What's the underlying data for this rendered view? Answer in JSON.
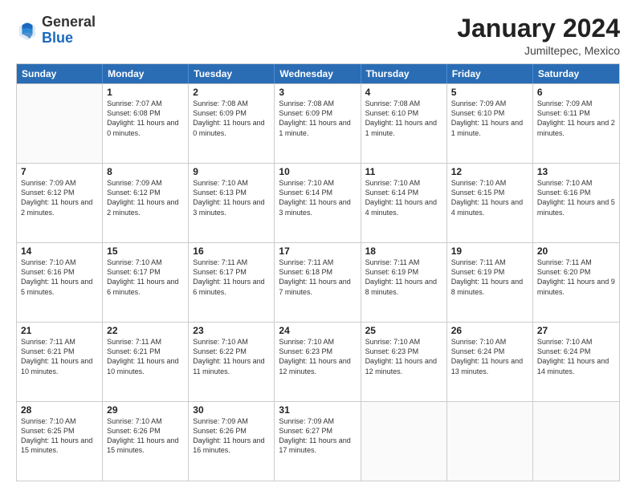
{
  "header": {
    "logo": {
      "general": "General",
      "blue": "Blue"
    },
    "title": "January 2024",
    "location": "Jumiltepec, Mexico"
  },
  "calendar": {
    "days_of_week": [
      "Sunday",
      "Monday",
      "Tuesday",
      "Wednesday",
      "Thursday",
      "Friday",
      "Saturday"
    ],
    "weeks": [
      [
        {
          "day": "",
          "sunrise": "",
          "sunset": "",
          "daylight": ""
        },
        {
          "day": "1",
          "sunrise": "Sunrise: 7:07 AM",
          "sunset": "Sunset: 6:08 PM",
          "daylight": "Daylight: 11 hours and 0 minutes."
        },
        {
          "day": "2",
          "sunrise": "Sunrise: 7:08 AM",
          "sunset": "Sunset: 6:09 PM",
          "daylight": "Daylight: 11 hours and 0 minutes."
        },
        {
          "day": "3",
          "sunrise": "Sunrise: 7:08 AM",
          "sunset": "Sunset: 6:09 PM",
          "daylight": "Daylight: 11 hours and 1 minute."
        },
        {
          "day": "4",
          "sunrise": "Sunrise: 7:08 AM",
          "sunset": "Sunset: 6:10 PM",
          "daylight": "Daylight: 11 hours and 1 minute."
        },
        {
          "day": "5",
          "sunrise": "Sunrise: 7:09 AM",
          "sunset": "Sunset: 6:10 PM",
          "daylight": "Daylight: 11 hours and 1 minute."
        },
        {
          "day": "6",
          "sunrise": "Sunrise: 7:09 AM",
          "sunset": "Sunset: 6:11 PM",
          "daylight": "Daylight: 11 hours and 2 minutes."
        }
      ],
      [
        {
          "day": "7",
          "sunrise": "Sunrise: 7:09 AM",
          "sunset": "Sunset: 6:12 PM",
          "daylight": "Daylight: 11 hours and 2 minutes."
        },
        {
          "day": "8",
          "sunrise": "Sunrise: 7:09 AM",
          "sunset": "Sunset: 6:12 PM",
          "daylight": "Daylight: 11 hours and 2 minutes."
        },
        {
          "day": "9",
          "sunrise": "Sunrise: 7:10 AM",
          "sunset": "Sunset: 6:13 PM",
          "daylight": "Daylight: 11 hours and 3 minutes."
        },
        {
          "day": "10",
          "sunrise": "Sunrise: 7:10 AM",
          "sunset": "Sunset: 6:14 PM",
          "daylight": "Daylight: 11 hours and 3 minutes."
        },
        {
          "day": "11",
          "sunrise": "Sunrise: 7:10 AM",
          "sunset": "Sunset: 6:14 PM",
          "daylight": "Daylight: 11 hours and 4 minutes."
        },
        {
          "day": "12",
          "sunrise": "Sunrise: 7:10 AM",
          "sunset": "Sunset: 6:15 PM",
          "daylight": "Daylight: 11 hours and 4 minutes."
        },
        {
          "day": "13",
          "sunrise": "Sunrise: 7:10 AM",
          "sunset": "Sunset: 6:16 PM",
          "daylight": "Daylight: 11 hours and 5 minutes."
        }
      ],
      [
        {
          "day": "14",
          "sunrise": "Sunrise: 7:10 AM",
          "sunset": "Sunset: 6:16 PM",
          "daylight": "Daylight: 11 hours and 5 minutes."
        },
        {
          "day": "15",
          "sunrise": "Sunrise: 7:10 AM",
          "sunset": "Sunset: 6:17 PM",
          "daylight": "Daylight: 11 hours and 6 minutes."
        },
        {
          "day": "16",
          "sunrise": "Sunrise: 7:11 AM",
          "sunset": "Sunset: 6:17 PM",
          "daylight": "Daylight: 11 hours and 6 minutes."
        },
        {
          "day": "17",
          "sunrise": "Sunrise: 7:11 AM",
          "sunset": "Sunset: 6:18 PM",
          "daylight": "Daylight: 11 hours and 7 minutes."
        },
        {
          "day": "18",
          "sunrise": "Sunrise: 7:11 AM",
          "sunset": "Sunset: 6:19 PM",
          "daylight": "Daylight: 11 hours and 8 minutes."
        },
        {
          "day": "19",
          "sunrise": "Sunrise: 7:11 AM",
          "sunset": "Sunset: 6:19 PM",
          "daylight": "Daylight: 11 hours and 8 minutes."
        },
        {
          "day": "20",
          "sunrise": "Sunrise: 7:11 AM",
          "sunset": "Sunset: 6:20 PM",
          "daylight": "Daylight: 11 hours and 9 minutes."
        }
      ],
      [
        {
          "day": "21",
          "sunrise": "Sunrise: 7:11 AM",
          "sunset": "Sunset: 6:21 PM",
          "daylight": "Daylight: 11 hours and 10 minutes."
        },
        {
          "day": "22",
          "sunrise": "Sunrise: 7:11 AM",
          "sunset": "Sunset: 6:21 PM",
          "daylight": "Daylight: 11 hours and 10 minutes."
        },
        {
          "day": "23",
          "sunrise": "Sunrise: 7:10 AM",
          "sunset": "Sunset: 6:22 PM",
          "daylight": "Daylight: 11 hours and 11 minutes."
        },
        {
          "day": "24",
          "sunrise": "Sunrise: 7:10 AM",
          "sunset": "Sunset: 6:23 PM",
          "daylight": "Daylight: 11 hours and 12 minutes."
        },
        {
          "day": "25",
          "sunrise": "Sunrise: 7:10 AM",
          "sunset": "Sunset: 6:23 PM",
          "daylight": "Daylight: 11 hours and 12 minutes."
        },
        {
          "day": "26",
          "sunrise": "Sunrise: 7:10 AM",
          "sunset": "Sunset: 6:24 PM",
          "daylight": "Daylight: 11 hours and 13 minutes."
        },
        {
          "day": "27",
          "sunrise": "Sunrise: 7:10 AM",
          "sunset": "Sunset: 6:24 PM",
          "daylight": "Daylight: 11 hours and 14 minutes."
        }
      ],
      [
        {
          "day": "28",
          "sunrise": "Sunrise: 7:10 AM",
          "sunset": "Sunset: 6:25 PM",
          "daylight": "Daylight: 11 hours and 15 minutes."
        },
        {
          "day": "29",
          "sunrise": "Sunrise: 7:10 AM",
          "sunset": "Sunset: 6:26 PM",
          "daylight": "Daylight: 11 hours and 15 minutes."
        },
        {
          "day": "30",
          "sunrise": "Sunrise: 7:09 AM",
          "sunset": "Sunset: 6:26 PM",
          "daylight": "Daylight: 11 hours and 16 minutes."
        },
        {
          "day": "31",
          "sunrise": "Sunrise: 7:09 AM",
          "sunset": "Sunset: 6:27 PM",
          "daylight": "Daylight: 11 hours and 17 minutes."
        },
        {
          "day": "",
          "sunrise": "",
          "sunset": "",
          "daylight": ""
        },
        {
          "day": "",
          "sunrise": "",
          "sunset": "",
          "daylight": ""
        },
        {
          "day": "",
          "sunrise": "",
          "sunset": "",
          "daylight": ""
        }
      ]
    ]
  }
}
